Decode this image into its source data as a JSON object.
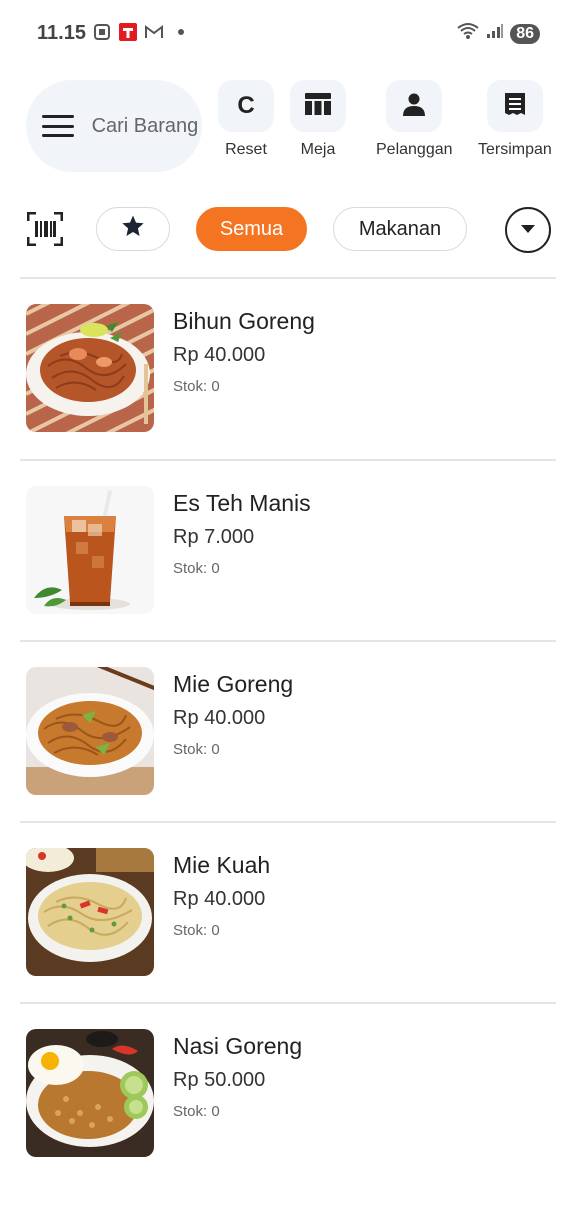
{
  "status_bar": {
    "time": "11.15",
    "battery": "86"
  },
  "header": {
    "search_placeholder": "Cari Barang",
    "buttons": [
      {
        "label": "Reset",
        "icon": "reset-c-icon",
        "glyph": "C"
      },
      {
        "label": "Meja",
        "icon": "table-icon"
      },
      {
        "label": "Pelanggan",
        "icon": "person-icon"
      },
      {
        "label": "Tersimpan",
        "icon": "receipt-icon"
      }
    ]
  },
  "filters": {
    "chips": [
      "Semua",
      "Makanan"
    ],
    "active": "Semua",
    "accent_color": "#f47421"
  },
  "products": [
    {
      "name": "Bihun Goreng",
      "price": "Rp 40.000",
      "stock": "Stok: 0"
    },
    {
      "name": "Es Teh Manis",
      "price": "Rp 7.000",
      "stock": "Stok: 0"
    },
    {
      "name": "Mie Goreng",
      "price": "Rp 40.000",
      "stock": "Stok: 0"
    },
    {
      "name": "Mie Kuah",
      "price": "Rp 40.000",
      "stock": "Stok: 0"
    },
    {
      "name": "Nasi Goreng",
      "price": "Rp 50.000",
      "stock": "Stok: 0"
    }
  ]
}
